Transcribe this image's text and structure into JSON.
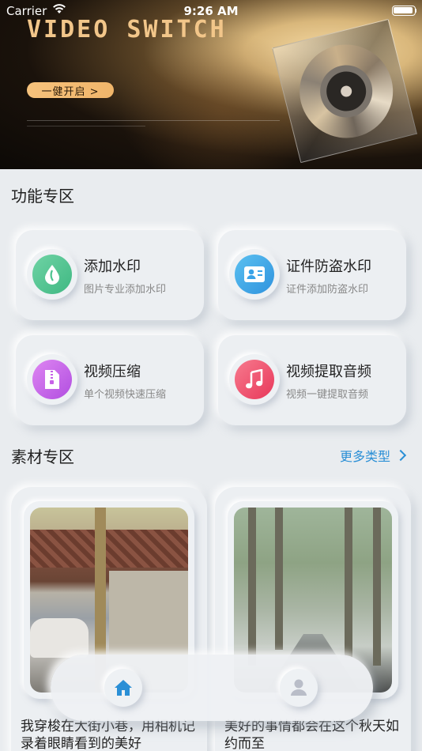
{
  "status_bar": {
    "carrier": "Carrier",
    "time": "9:26 AM"
  },
  "banner": {
    "title": "VIDEO SWITCH",
    "button_label": "一健开启 >"
  },
  "features": {
    "title": "功能专区",
    "items": [
      {
        "title": "添加水印",
        "subtitle": "图片专业添加水印",
        "icon": "droplet-icon",
        "color": "#4cc48f"
      },
      {
        "title": "证件防盗水印",
        "subtitle": "证件添加防盗水印",
        "icon": "id-card-icon",
        "color": "#3aa3e8"
      },
      {
        "title": "视频压缩",
        "subtitle": "单个视频快速压缩",
        "icon": "zip-file-icon",
        "color": "#c861e8"
      },
      {
        "title": "视频提取音频",
        "subtitle": "视频一键提取音频",
        "icon": "music-note-icon",
        "color": "#f0506e"
      }
    ]
  },
  "materials": {
    "title": "素材专区",
    "more_label": "更多类型",
    "items": [
      {
        "caption": "我穿梭在大街小巷，用相机记录着眼睛看到的美好"
      },
      {
        "caption": "美好的事情都会在这个秋天如约而至"
      }
    ]
  },
  "tabbar": {
    "items": [
      "home-icon",
      "profile-icon"
    ],
    "active_color": "#2a8fd6",
    "inactive_color": "#b9bdc8"
  }
}
